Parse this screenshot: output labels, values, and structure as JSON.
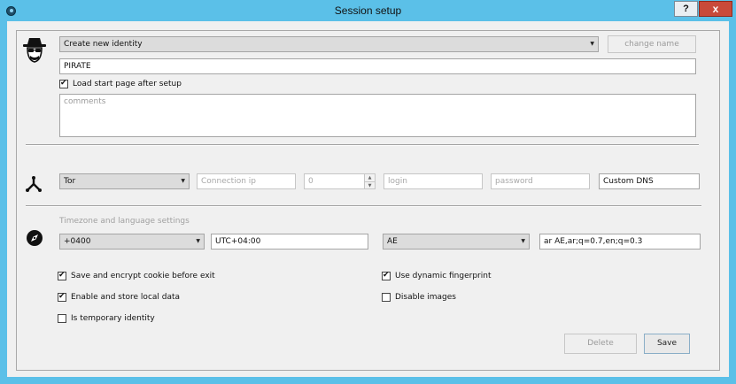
{
  "window": {
    "title": "Session setup",
    "help_label": "?",
    "close_label": "x"
  },
  "identity": {
    "mode_select": "Create new identity",
    "change_name_label": "change name",
    "name_value": "PIRATE",
    "load_start_page_label": "Load start page after setup",
    "load_start_page_checked": true,
    "comments_placeholder": "comments"
  },
  "connection": {
    "proxy_type": "Tor",
    "ip_placeholder": "Connection ip",
    "port_value": "0",
    "login_placeholder": "login",
    "password_placeholder": "password",
    "dns_value": "Custom DNS"
  },
  "locale": {
    "section_title": "Timezone and language settings",
    "timezone_offset": "+0400",
    "timezone_name": "UTC+04:00",
    "country": "AE",
    "accept_language": "ar AE,ar;q=0.7,en;q=0.3"
  },
  "options": {
    "save_cookie": {
      "label": "Save and encrypt cookie before exit",
      "checked": true
    },
    "local_data": {
      "label": "Enable and store local data",
      "checked": true
    },
    "temporary": {
      "label": "Is temporary identity",
      "checked": false
    },
    "dynamic_fingerprint": {
      "label": "Use dynamic fingerprint",
      "checked": true
    },
    "disable_images": {
      "label": "Disable images",
      "checked": false
    }
  },
  "actions": {
    "delete_label": "Delete",
    "save_label": "Save"
  },
  "icons": {
    "identity": "spy-icon",
    "connection": "network-nodes-icon",
    "locale": "compass-icon"
  }
}
